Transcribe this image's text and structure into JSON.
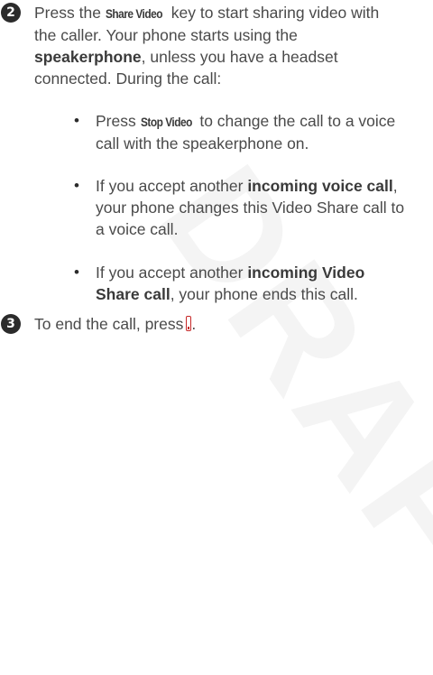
{
  "watermark": "DRAFT",
  "step2": {
    "number": "2",
    "text_a": "Press the ",
    "key": "Share Video",
    "text_b": " key to start sharing video with",
    "line2": "the caller. Your phone starts using the",
    "bold_speakerphone": "speakerphone",
    "text_c": ", unless you have a headset",
    "line4": "connected. During the call:"
  },
  "bullets": [
    {
      "dot": "•",
      "a": "Press ",
      "key": "Stop Video",
      "b": " to change the call to a voice",
      "line2": "call with the speakerphone on."
    },
    {
      "dot": "•",
      "a": "If you accept another ",
      "bold": "incoming voice call",
      "b": ",",
      "line2": "your phone changes this Video Share call to",
      "line3": "a voice call."
    },
    {
      "dot": "•",
      "a": "If you accept another ",
      "bold1": "incoming Video",
      "bold2": "Share call",
      "b": ", your phone ends this call."
    }
  ],
  "step3": {
    "number": "3",
    "text": "To end the call, press",
    "end_key_icon": "end-key-icon",
    "period": "."
  },
  "colors": {
    "text": "#4a4a4a",
    "end_key": "#c62828"
  }
}
